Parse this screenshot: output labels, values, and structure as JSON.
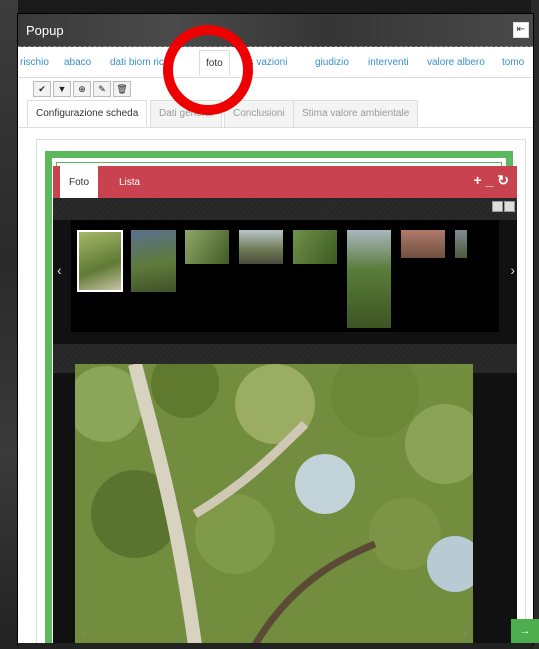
{
  "popup": {
    "title": "Popup",
    "exit_icon": "exit-icon"
  },
  "main_tabs": [
    {
      "label": "rischio"
    },
    {
      "label": "abaco"
    },
    {
      "label": "dati biom  rici"
    },
    {
      "label": "foto"
    },
    {
      "label": "os  vazioni"
    },
    {
      "label": "giudizio"
    },
    {
      "label": "interventi"
    },
    {
      "label": "valore albero"
    },
    {
      "label": "tomo"
    }
  ],
  "toolbar": {
    "icons": [
      "check-icon",
      "filter-icon",
      "zoom-icon",
      "pencil-icon",
      "trash-icon"
    ],
    "glyphs": [
      "✔",
      "▼",
      "⊕",
      "✎",
      "🗑"
    ]
  },
  "subtabs": [
    {
      "label": "Configurazione scheda"
    },
    {
      "label": "Dati general"
    },
    {
      "label": "Conclusioni"
    },
    {
      "label": "Stima valore ambientale"
    }
  ],
  "photo_panel": {
    "tab_foto": "Foto",
    "tab_lista": "Lista",
    "add_glyph": "+",
    "minus_glyph": "_",
    "refresh_glyph": "↻"
  },
  "colors": {
    "panel_red": "#c9424f",
    "frame_green": "#5cb85c",
    "link_blue": "#3a8fd0",
    "annotation_red": "#e00000"
  },
  "green_corner_glyph": "→"
}
